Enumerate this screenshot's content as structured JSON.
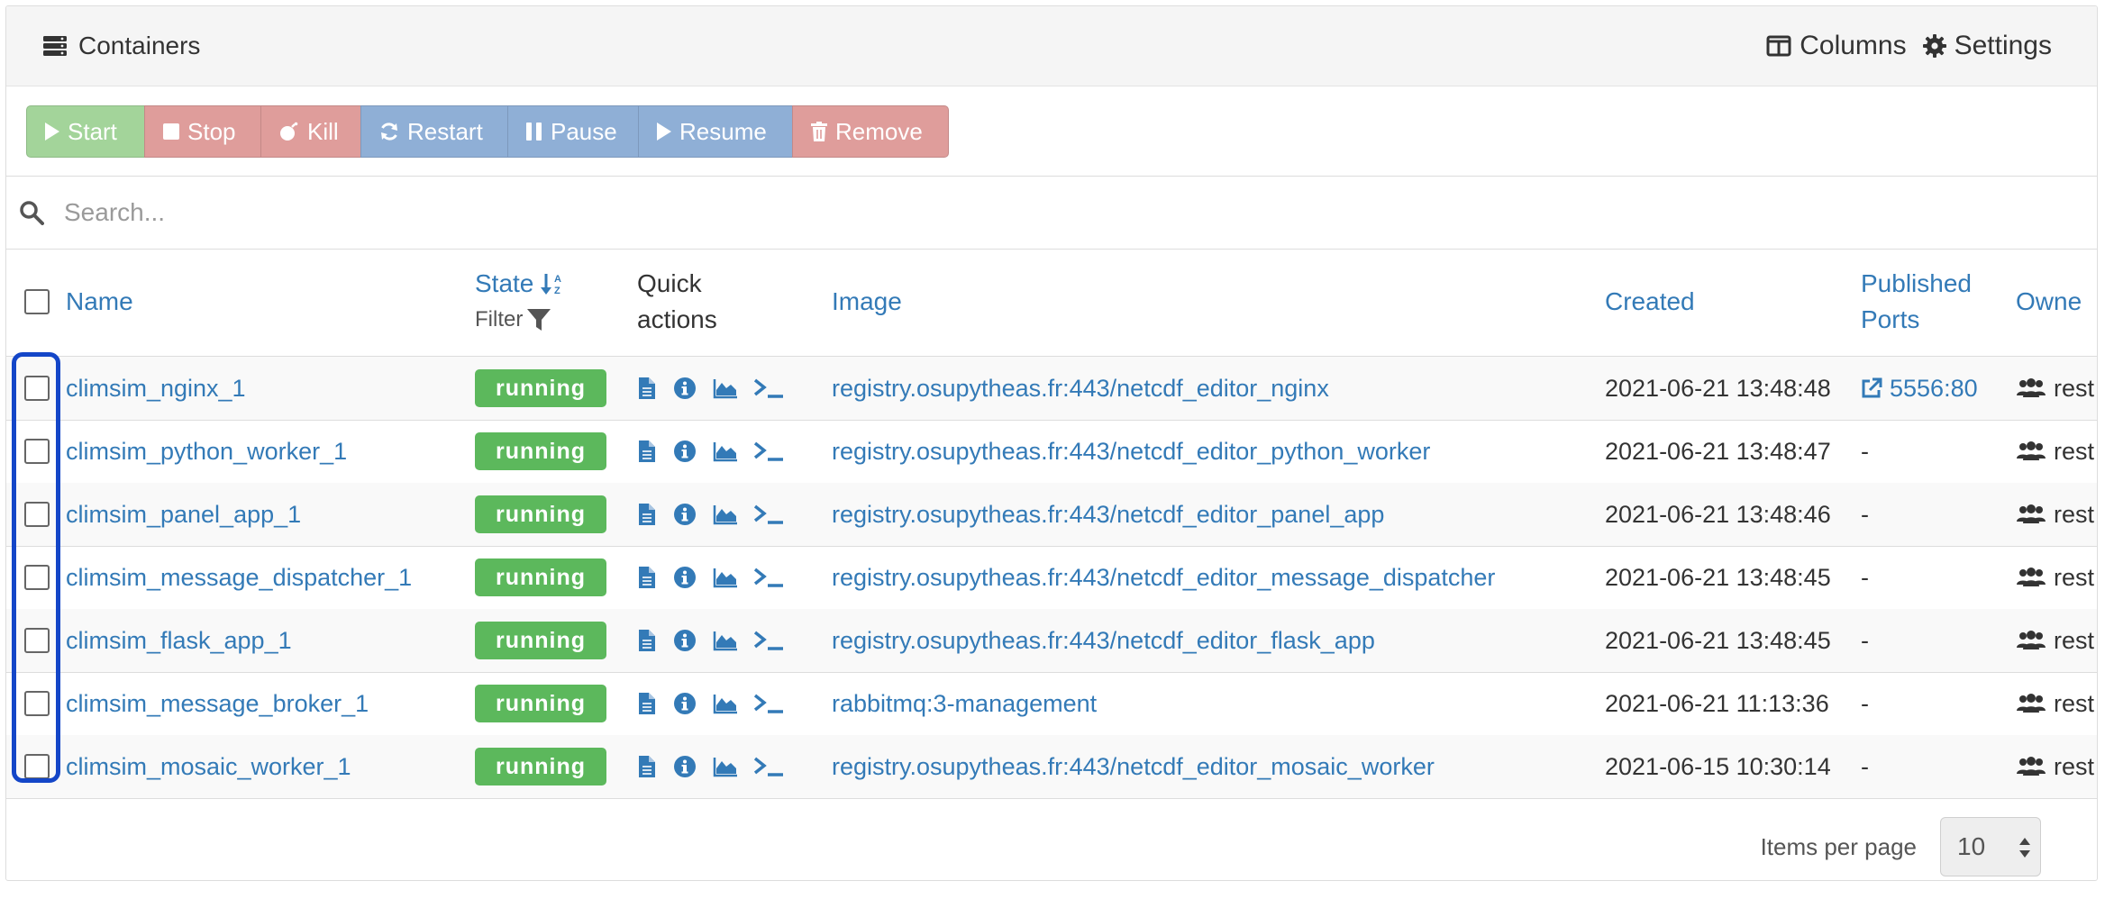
{
  "widget": {
    "title": "Containers",
    "columns_label": "Columns",
    "settings_label": "Settings"
  },
  "actions": {
    "start": "Start",
    "stop": "Stop",
    "kill": "Kill",
    "restart": "Restart",
    "pause": "Pause",
    "resume": "Resume",
    "remove": "Remove"
  },
  "search": {
    "placeholder": "Search..."
  },
  "table": {
    "headers": {
      "name": "Name",
      "state": "State",
      "state_filter": "Filter",
      "quick_actions_line1": "Quick",
      "quick_actions_line2": "actions",
      "image": "Image",
      "created": "Created",
      "published_ports_line1": "Published",
      "published_ports_line2": "Ports",
      "ownership": "Owne"
    },
    "rows": [
      {
        "name": "climsim_nginx_1",
        "state": "running",
        "image": "registry.osupytheas.fr:443/netcdf_editor_nginx",
        "created": "2021-06-21 13:48:48",
        "ports": "5556:80",
        "owner": "rest"
      },
      {
        "name": "climsim_python_worker_1",
        "state": "running",
        "image": "registry.osupytheas.fr:443/netcdf_editor_python_worker",
        "created": "2021-06-21 13:48:47",
        "ports": "-",
        "owner": "rest"
      },
      {
        "name": "climsim_panel_app_1",
        "state": "running",
        "image": "registry.osupytheas.fr:443/netcdf_editor_panel_app",
        "created": "2021-06-21 13:48:46",
        "ports": "-",
        "owner": "rest"
      },
      {
        "name": "climsim_message_dispatcher_1",
        "state": "running",
        "image": "registry.osupytheas.fr:443/netcdf_editor_message_dispatcher",
        "created": "2021-06-21 13:48:45",
        "ports": "-",
        "owner": "rest"
      },
      {
        "name": "climsim_flask_app_1",
        "state": "running",
        "image": "registry.osupytheas.fr:443/netcdf_editor_flask_app",
        "created": "2021-06-21 13:48:45",
        "ports": "-",
        "owner": "rest"
      },
      {
        "name": "climsim_message_broker_1",
        "state": "running",
        "image": "rabbitmq:3-management",
        "created": "2021-06-21 11:13:36",
        "ports": "-",
        "owner": "rest"
      },
      {
        "name": "climsim_mosaic_worker_1",
        "state": "running",
        "image": "registry.osupytheas.fr:443/netcdf_editor_mosaic_worker",
        "created": "2021-06-15 10:30:14",
        "ports": "-",
        "owner": "rest"
      }
    ]
  },
  "pagination": {
    "label": "Items per page",
    "value": "10"
  },
  "colors": {
    "link": "#337ab7",
    "running": "#5cb85c",
    "start": "#a3d49a",
    "danger": "#df9d9b",
    "primary": "#8fafd6",
    "highlight": "#1446c8"
  },
  "icons": {
    "header": "server-icon",
    "columns": "columns-icon",
    "settings": "gear-icon",
    "search": "search-icon",
    "sort": "sort-alpha-down-icon",
    "filter": "filter-icon",
    "quick_actions": [
      "file-icon",
      "info-icon",
      "area-chart-icon",
      "terminal-icon"
    ],
    "ports": "external-link-icon",
    "owner": "users-icon"
  }
}
